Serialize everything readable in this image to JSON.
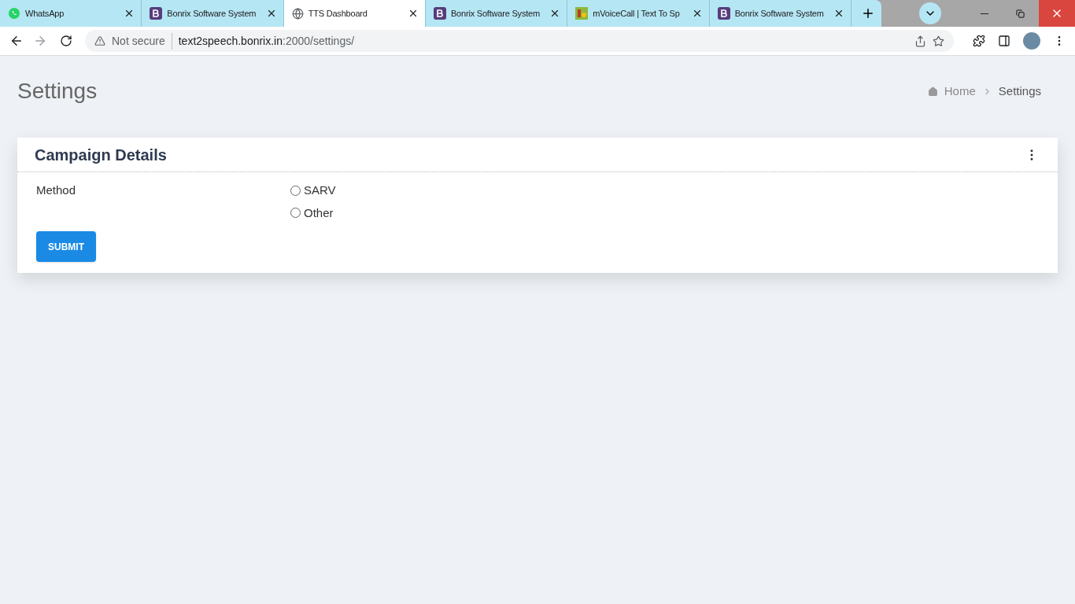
{
  "tabs": [
    {
      "title": "WhatsApp",
      "kind": "whatsapp",
      "selected": false
    },
    {
      "title": "Bonrix Software System",
      "kind": "bootstrap",
      "selected": false
    },
    {
      "title": "TTS Dashboard",
      "kind": "globe",
      "selected": true
    },
    {
      "title": "Bonrix Software System",
      "kind": "bootstrap",
      "selected": false
    },
    {
      "title": "mVoiceCall | Text To Sp",
      "kind": "image",
      "selected": false
    },
    {
      "title": "Bonrix Software System",
      "kind": "bootstrap",
      "selected": false
    }
  ],
  "address_bar": {
    "security": "Not secure",
    "host": "text2speech.bonrix.in",
    "path": ":2000/settings/"
  },
  "page": {
    "title": "Settings",
    "breadcrumb": [
      {
        "label": "Home",
        "kind": "home"
      },
      {
        "label": "Settings",
        "kind": "current"
      }
    ]
  },
  "card": {
    "title": "Campaign Details",
    "field_label": "Method",
    "options": [
      {
        "label": "SARV",
        "selected": false
      },
      {
        "label": "Other",
        "selected": false
      }
    ],
    "submit": "SUBMIT"
  }
}
